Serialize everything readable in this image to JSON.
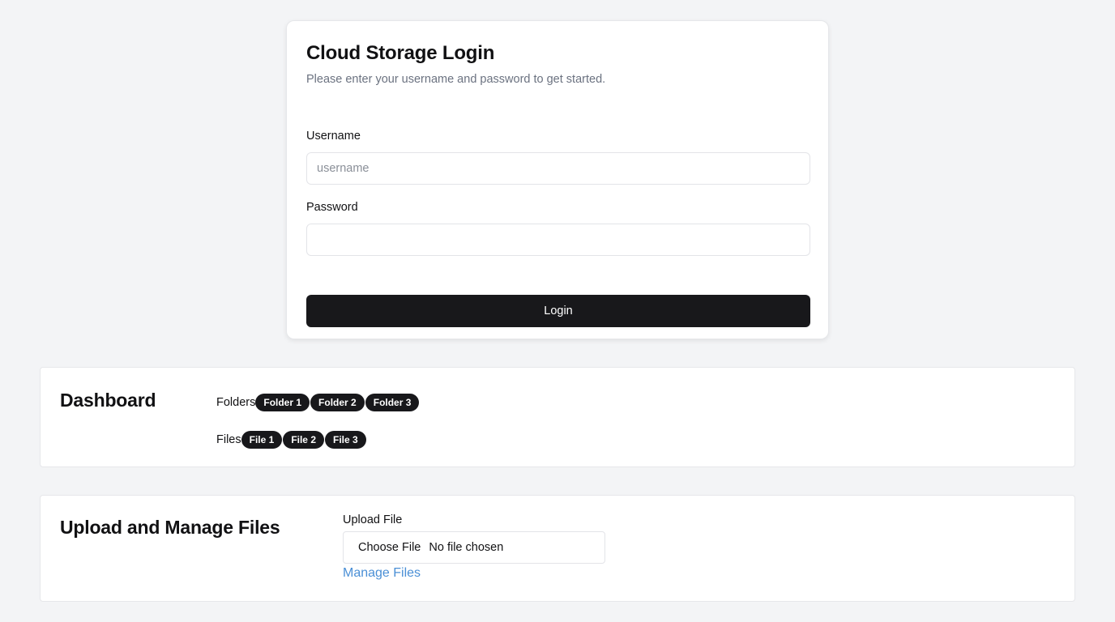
{
  "login": {
    "title": "Cloud Storage Login",
    "subtitle": "Please enter your username and password to get started.",
    "username_label": "Username",
    "username_placeholder": "username",
    "username_value": "",
    "password_label": "Password",
    "password_value": "",
    "login_button": "Login"
  },
  "dashboard": {
    "title": "Dashboard",
    "folders_label": "Folders",
    "folders": [
      "Folder 1",
      "Folder 2",
      "Folder 3"
    ],
    "files_label": "Files",
    "files": [
      "File 1",
      "File 2",
      "File 3"
    ]
  },
  "upload": {
    "title": "Upload and Manage Files",
    "upload_label": "Upload File",
    "choose_file_label": "Choose File",
    "no_file_text": "No file chosen",
    "manage_link": "Manage Files"
  },
  "colors": {
    "background": "#f3f4f6",
    "primary_button": "#18181b",
    "link": "#4a8fd6",
    "muted_text": "#6b7280"
  }
}
